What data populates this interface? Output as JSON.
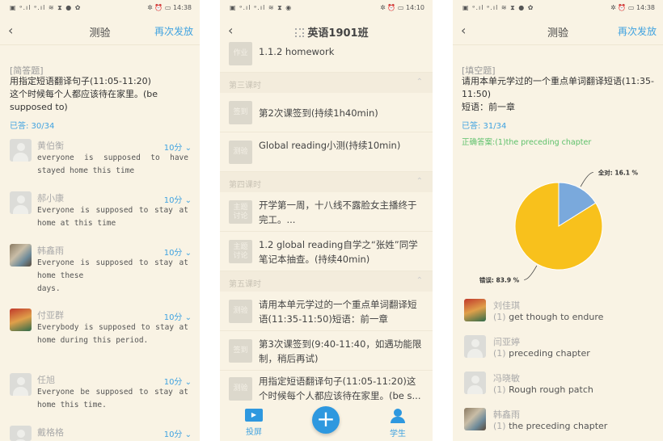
{
  "left": {
    "status": {
      "left": "▣ ᵊ.ıl ᵊ.ıl ≋ ⧗ ● ✿",
      "right": "✲ ⏰ ▭ 14:38"
    },
    "title": "测验",
    "back": "‹",
    "redo": "再次发放",
    "qtype": "[简答题]",
    "question": [
      "用指定短语翻译句子(11:05-11:20)",
      "这个时候每个人都应该待在家里。(be supposed to)"
    ],
    "answered": "已答: 30/34",
    "answers": [
      {
        "name": "黄伯衡",
        "score": "10分",
        "text": "everyone is supposed to have stayed home this time",
        "avatar": "default"
      },
      {
        "name": "郝小康",
        "score": "10分",
        "text": "Everyone is supposed to  stay at home at this time",
        "avatar": "default"
      },
      {
        "name": "韩鑫雨",
        "score": "10分",
        "text": "Everyone is supposed to stay at home these\n days.",
        "avatar": "photo"
      },
      {
        "name": "付亚群",
        "score": "10分",
        "text": "Everybody is supposed to stay at home during this period.",
        "avatar": "illustration"
      },
      {
        "name": "任旭",
        "score": "10分",
        "text": "Everyone be supposed to stay at home this time.",
        "avatar": "default"
      },
      {
        "name": "戴格格",
        "score": "10分",
        "text": "",
        "avatar": "default"
      }
    ]
  },
  "middle": {
    "status": {
      "left": "▣ ᵊ.ıl ᵊ.ıl ≋ ⧗ ◉",
      "right": "✲ ⏰ ▭ 14:10"
    },
    "back": "‹",
    "qr_icon": "qr-code-icon",
    "title": "英语1901班",
    "rows": [
      {
        "kind": "item",
        "tag": "作业",
        "text": "1.1.2 homework"
      },
      {
        "kind": "section",
        "text": "第三课时"
      },
      {
        "kind": "item",
        "tag": "签到",
        "text": "第2次课签到(持续1h40min)"
      },
      {
        "kind": "item",
        "tag": "测验",
        "text": "Global reading小测(持续10min)"
      },
      {
        "kind": "section",
        "text": "第四课时"
      },
      {
        "kind": "item",
        "tag": "主题讨论",
        "text": "开学第一周，十八线不露脸女主播终于完工。..."
      },
      {
        "kind": "item",
        "tag": "主题讨论",
        "text": "1.2 global reading自学之“张姓”同学笔记本抽查。(持续40min)"
      },
      {
        "kind": "section",
        "text": "第五课时"
      },
      {
        "kind": "item",
        "tag": "测验",
        "text": "请用本单元学过的一个重点单词翻译短语(11:35-11:50)短语：前一章"
      },
      {
        "kind": "item",
        "tag": "签到",
        "text": "第3次课签到(9:40-11:40，如遇功能限制，稍后再试)"
      },
      {
        "kind": "item",
        "tag": "测验",
        "text": "用指定短语翻译句子(11:05-11:20)这个时候每个人都应该待在家里。(be s..."
      }
    ],
    "nav": {
      "projection": "投屏",
      "add": "+",
      "students": "学生"
    }
  },
  "right": {
    "status": {
      "left": "▣ ᵊ.ıl ᵊ.ıl ≋ ⧗ ● ✿",
      "right": "✲ ⏰ ▭ 14:38"
    },
    "title": "测验",
    "back": "‹",
    "redo": "再次发放",
    "qtype": "[填空题]",
    "question": [
      "请用本单元学过的一个重点单词翻译短语(11:35-11:50)",
      "短语：前一章"
    ],
    "answered": "已答: 31/34",
    "correct_label": "正确答案:",
    "correct_value": "(1)the preceding chapter",
    "chart_data": {
      "type": "pie",
      "slices": [
        {
          "label": "全对",
          "value": 16.1,
          "display": "全对: 16.1 %",
          "color": "#7aa9dc"
        },
        {
          "label": "错误",
          "value": 83.9,
          "display": "错误: 83.9 %",
          "color": "#f8c11c"
        }
      ]
    },
    "answers": [
      {
        "name": "刘佳琪",
        "num": "(1)",
        "text": "get though to endure",
        "avatar": "illustration"
      },
      {
        "name": "闫亚婷",
        "num": "(1)",
        "text": "preceding chapter",
        "avatar": "default"
      },
      {
        "name": "冯晓敏",
        "num": "(1)",
        "text": "Rough rough patch",
        "avatar": "default"
      },
      {
        "name": "韩鑫雨",
        "num": "(1)",
        "text": "the preceding chapter",
        "avatar": "photo"
      }
    ]
  }
}
